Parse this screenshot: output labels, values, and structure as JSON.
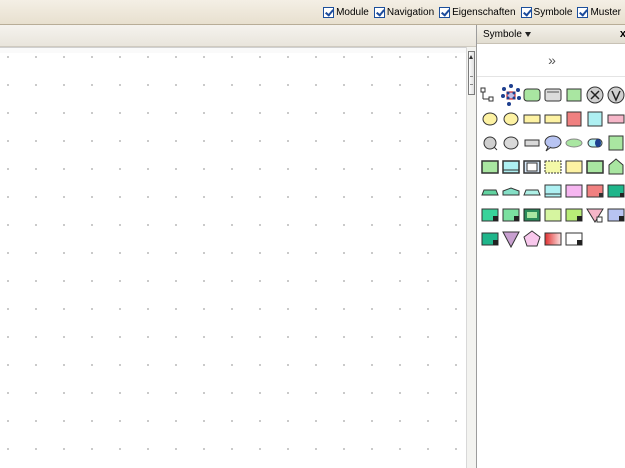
{
  "toolbar": {
    "checkboxes": [
      {
        "label": "Module",
        "checked": true
      },
      {
        "label": "Navigation",
        "checked": true
      },
      {
        "label": "Eigenschaften",
        "checked": true
      },
      {
        "label": "Symbole",
        "checked": true
      },
      {
        "label": "Muster",
        "checked": true
      }
    ]
  },
  "panel": {
    "title": "Symbole",
    "close_glyph": "x",
    "expand_glyph": "»"
  },
  "palette": {
    "rows": [
      [
        "small-rectangles-icon",
        "connection-points-icon",
        "green-rounded-rectangle-icon",
        "gray-database-icon",
        "green-square-icon",
        "circle-x-icon",
        "circle-v-icon"
      ],
      [
        "yellow-circle-icon",
        "yellow-ellipse-icon",
        "yellow-rectangle-icon",
        "yellow-wide-rectangle-icon",
        "red-square-icon",
        "cyan-square-icon",
        "pink-rectangle-icon"
      ],
      [
        "gray-ellipse-icon",
        "gray-oval-icon",
        "gray-small-rectangle-icon",
        "blue-speech-ellipse-icon",
        "green-oval-icon",
        "cyan-cylinder-icon",
        "green-outline-square-icon"
      ],
      [
        "green-square-icon",
        "cyan-square-icon",
        "blue-square-icon",
        "yellow-dashed-square-icon",
        "yellow-square-icon",
        "green-dark-square-icon",
        "green-pentagon-icon"
      ],
      [
        "green-arch-icon",
        "teal-arch-icon",
        "teal-arch-outline-icon",
        "cyan-rectangle-icon",
        "pink-square-icon",
        "red-notch-square-icon",
        "teal-corner-square-icon"
      ],
      [
        "green-corner-square-icon",
        "green-notch-square-icon",
        "dark-green-frame-icon",
        "light-green-square-icon",
        "lime-notch-square-icon",
        "pink-triangle-icon",
        "blue-notch-square-icon"
      ],
      [
        "teal-notch-square-icon",
        "purple-triangle-icon",
        "pink-pentagon-icon",
        "red-gradient-square-icon",
        "white-notch-square-icon"
      ]
    ]
  },
  "colors": {
    "toolbar_bg": "#e8e0cf",
    "panel_border": "#9c9c9c",
    "checkbox_blue": "#1c4f9c"
  }
}
